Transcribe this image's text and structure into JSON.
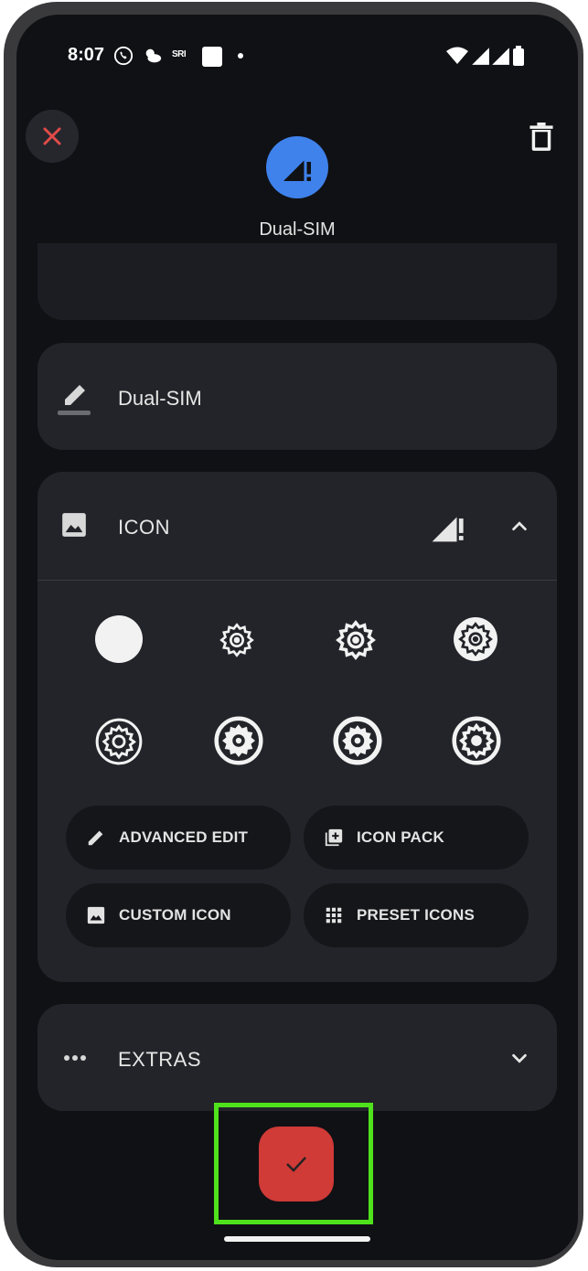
{
  "status_bar": {
    "time": "8:07",
    "extra_label": "SRI"
  },
  "header": {
    "tile_name": "Dual-SIM"
  },
  "name_section": {
    "value": "Dual-SIM"
  },
  "icon_section": {
    "label": "ICON",
    "buttons": {
      "advanced_edit": "ADVANCED EDIT",
      "icon_pack": "ICON PACK",
      "custom_icon": "CUSTOM ICON",
      "preset_icons": "PRESET ICONS"
    }
  },
  "extras_section": {
    "label": "EXTRAS"
  },
  "colors": {
    "accent_blue": "#3f82ec",
    "save_red": "#d03a37",
    "close_red": "#e04b49",
    "highlight_green": "#4fe21c"
  }
}
